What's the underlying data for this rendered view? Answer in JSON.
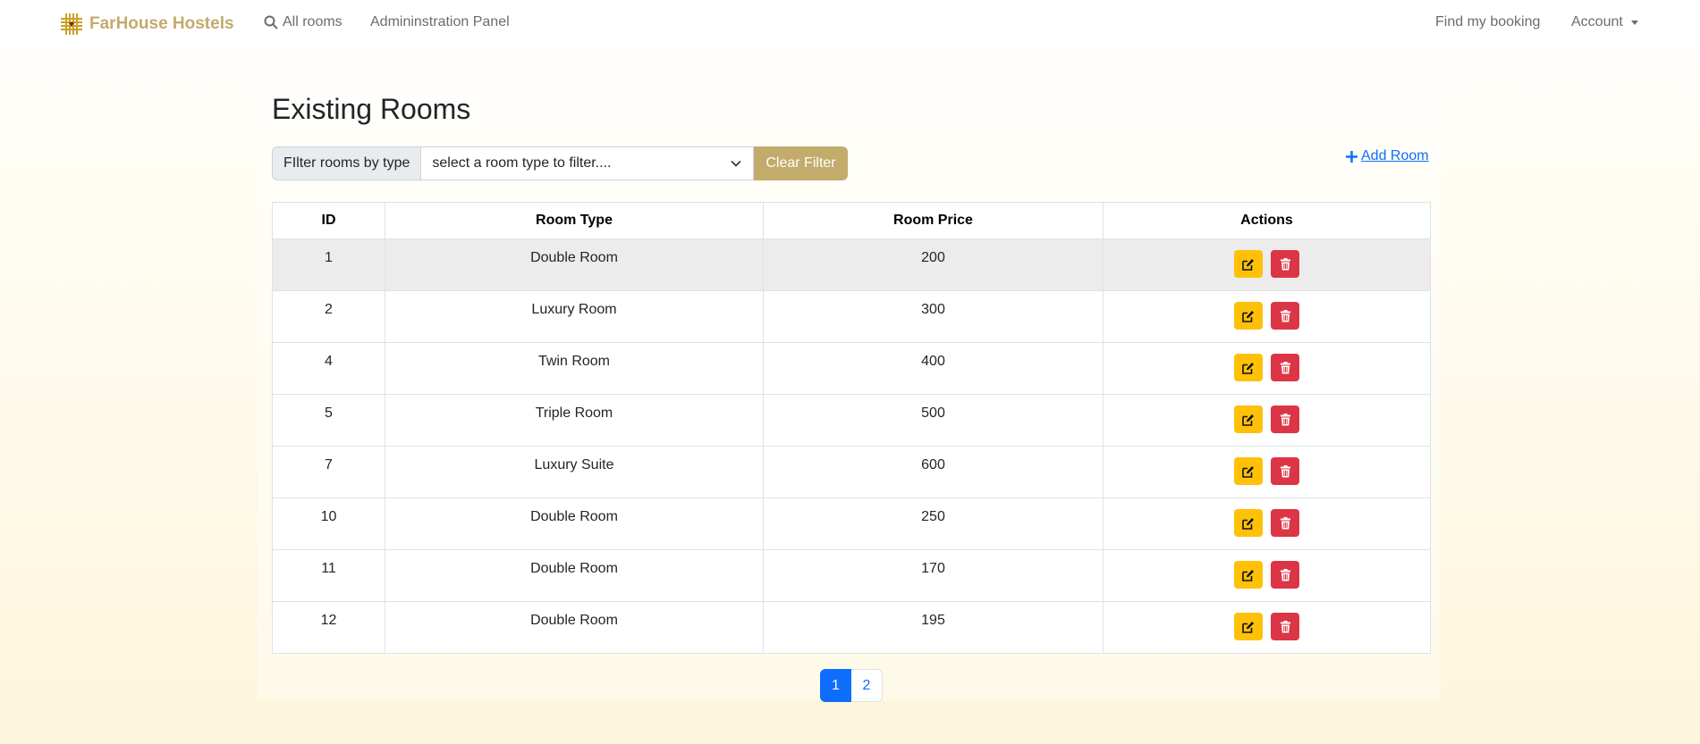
{
  "navbar": {
    "brand": "FarHouse Hostels",
    "links": {
      "all_rooms": "All rooms",
      "admin_panel": "Admininstration Panel",
      "find_booking": "Find my booking",
      "account": "Account"
    }
  },
  "page": {
    "title": "Existing Rooms",
    "filter": {
      "label": "FIlter rooms by type",
      "select_value": "select a room type to filter....",
      "clear_label": "Clear Filter"
    },
    "add_room_label": " Add Room"
  },
  "table": {
    "headers": [
      "ID",
      "Room Type",
      "Room Price",
      "Actions"
    ],
    "rows": [
      {
        "id": "1",
        "type": "Double Room",
        "price": "200"
      },
      {
        "id": "2",
        "type": "Luxury Room",
        "price": "300"
      },
      {
        "id": "4",
        "type": "Twin Room",
        "price": "400"
      },
      {
        "id": "5",
        "type": "Triple Room",
        "price": "500"
      },
      {
        "id": "7",
        "type": "Luxury Suite",
        "price": "600"
      },
      {
        "id": "10",
        "type": "Double Room",
        "price": "250"
      },
      {
        "id": "11",
        "type": "Double Room",
        "price": "170"
      },
      {
        "id": "12",
        "type": "Double Room",
        "price": "195"
      }
    ]
  },
  "pagination": {
    "pages": [
      "1",
      "2"
    ],
    "current": "1"
  },
  "icons": {
    "brand": "hostel-logo-icon",
    "search": "search-icon",
    "plus": "plus-icon",
    "edit": "edit-icon",
    "delete": "trash-icon",
    "select": "chevron-down-icon"
  },
  "colors": {
    "brand": "#c2ab6b",
    "primary": "#0d6efd",
    "warning": "#ffc107",
    "danger": "#dc3545"
  }
}
